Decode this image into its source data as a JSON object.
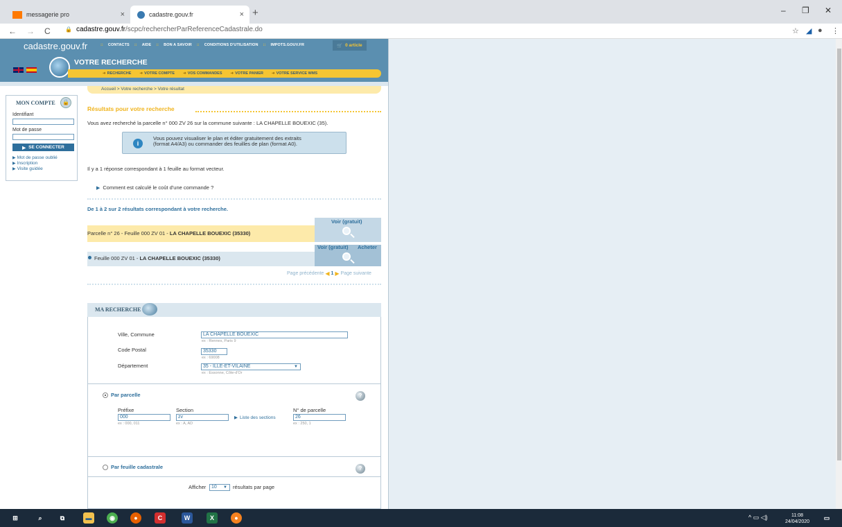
{
  "browser": {
    "tabs": [
      {
        "title": "messagerie pro",
        "active": false
      },
      {
        "title": "cadastre.gouv.fr",
        "active": true
      }
    ],
    "url_host": "cadastre.gouv.fr",
    "url_path": "/scpc/rechercherParReferenceCadastrale.do",
    "new_tab": "+",
    "close": "×",
    "minimize": "–",
    "maximize": "❐",
    "win_close": "✕"
  },
  "header": {
    "logo": "cadastre.gouv.fr",
    "top_nav": [
      "CONTACTS",
      "AIDE",
      "BON A SAVOIR",
      "CONDITIONS D'UTILISATION",
      "IMPOTS.GOUV.FR"
    ],
    "cart": "0 article",
    "section_title": "VOTRE RECHERCHE",
    "sub_nav": [
      "RECHERCHE",
      "VOTRE COMPTE",
      "VOS COMMANDES",
      "VOTRE PANIER",
      "VOTRE SERVICE WMS"
    ],
    "breadcrumb": "Accueil > Votre recherche > Votre résultat"
  },
  "account": {
    "title": "MON COMPTE",
    "identifiant_label": "Identifiant",
    "password_label": "Mot de passe",
    "connect_label": "SE CONNECTER",
    "links": [
      "Mot de passe oublié",
      "Inscription",
      "Visite guidée"
    ]
  },
  "main": {
    "results_title": "Résultats pour votre recherche",
    "search_summary": "Vous avez recherché la parcelle n° 000 ZV 26 sur la commune suivante : LA CHAPELLE BOUEXIC (35).",
    "info_line1": "Vous pouvez visualiser le plan et éditer gratuitement des extraits",
    "info_line2": "(format A4/A3) ou commander des feuilles de plan (format A0).",
    "answer_count": "Il y a 1 réponse correspondant à 1 feuille au format vecteur.",
    "cost_link": "Comment est calculé le coût d'une commande ?",
    "result_count": "De 1 à 2 sur 2 résultats correspondant à votre recherche.",
    "row1_prefix": "Parcelle n° 26 - Feuille 000 ZV 01 - ",
    "row1_bold": "LA CHAPELLE BOUEXIC (35330)",
    "row2_prefix": "Feuille 000 ZV 01 - ",
    "row2_bold": "LA CHAPELLE BOUEXIC (35330)",
    "voir_gratuit": "Voir (gratuit)",
    "acheter": "Acheter",
    "pager_prev": "Page précédente",
    "pager_num": "1",
    "pager_next": "Page suivante"
  },
  "search": {
    "title": "MA RECHERCHE",
    "ville_label": "Ville, Commune",
    "ville_value": "LA CHAPELLE BOUEXIC",
    "ville_hint": "ex : Rennes, Paris 9",
    "cp_label": "Code Postal",
    "cp_value": "35330",
    "cp_hint": "ex : 69008",
    "dept_label": "Département",
    "dept_value": "35 - ILLE-ET-VILAINE",
    "dept_hint": "ex : Essonne, Côte-d'Or",
    "par_parcelle": "Par parcelle",
    "prefixe_label": "Préfixe",
    "prefixe_value": "000",
    "prefixe_hint": "ex : 000, 011",
    "section_label": "Section",
    "section_value": "zv",
    "section_hint": "ex : A, AD",
    "sections_link": "Liste des sections",
    "parcelle_label": "N° de parcelle",
    "parcelle_value": "26",
    "parcelle_hint": "ex : 250, 1",
    "par_feuille": "Par feuille cadastrale",
    "afficher": "Afficher",
    "per_page_value": "10",
    "per_page_suffix": "résultats par page"
  },
  "taskbar": {
    "time": "11:08",
    "date": "24/04/2020"
  }
}
